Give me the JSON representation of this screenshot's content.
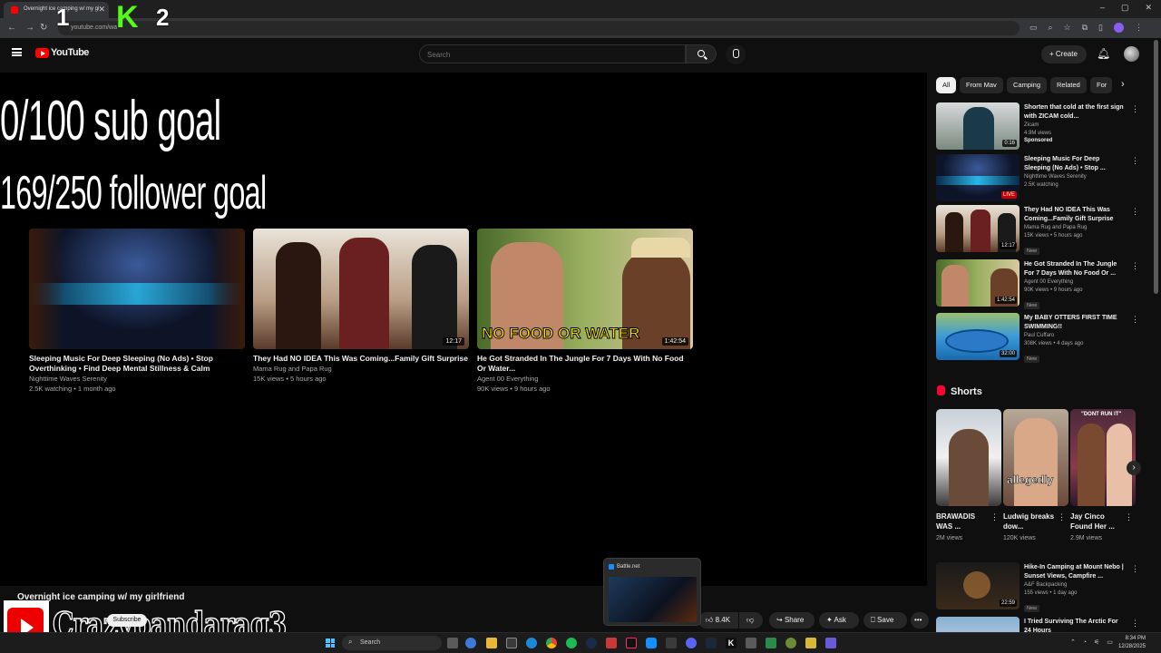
{
  "browser": {
    "tab_title": "Overnight ice camping w/ my gi",
    "url": "youtube.com/wa",
    "window_controls": [
      "–",
      "▢",
      "✕"
    ],
    "overlay_numbers": [
      "1",
      "2"
    ],
    "kick_logo": "K"
  },
  "header": {
    "brand": "YouTube",
    "search_placeholder": "Search",
    "create_label": "Create"
  },
  "player": {
    "goals": [
      "0/100 sub goal",
      "169/250 follower goal"
    ],
    "end_cards": [
      {
        "title": "Sleeping Music For Deep Sleeping (No Ads) • Stop Overthinking • Find Deep Mental Stillness & Calm",
        "channel": "Nighttime Waves Serenity",
        "meta": "2.5K watching • 1 month ago",
        "duration": ""
      },
      {
        "title": "They Had NO IDEA This Was Coming...Family Gift Surprise",
        "channel": "Mama Rug and Papa Rug",
        "meta": "15K views • 5 hours ago",
        "duration": "12:17"
      },
      {
        "title": "He Got Stranded In The Jungle For 7 Days With No Food Or Water...",
        "channel": "Agent 00 Everything",
        "meta": "90K views • 9 hours ago",
        "duration": "1:42:54",
        "thumb_text": "NO FOOD OR WATER"
      }
    ]
  },
  "video": {
    "title": "Overnight ice camping w/ my girlfriend",
    "subscribe_label": "Subscribe",
    "streamer_name": "Crazypandarag3",
    "actions": {
      "likes": "8.4K",
      "share": "Share",
      "ask": "Ask",
      "save": "Save",
      "more": "•••"
    }
  },
  "chips": [
    "All",
    "From Mav",
    "Camping",
    "Related",
    "For"
  ],
  "recommendations": [
    {
      "title": "Shorten that cold at the first sign with ZICAM cold...",
      "channel": "Zicam",
      "meta": "4.9M views",
      "badge": "",
      "sponsored": "Sponsored",
      "duration": "0:16"
    },
    {
      "title": "Sleeping Music For Deep Sleeping (No Ads) • Stop ...",
      "channel": "Nighttime Waves Serenity",
      "meta": "2.5K watching",
      "badge": "",
      "sponsored": "",
      "duration": "LIVE"
    },
    {
      "title": "They Had NO IDEA This Was Coming...Family Gift Surprise",
      "channel": "Mama Rug and Papa Rug",
      "meta": "15K views • 5 hours ago",
      "badge": "New",
      "sponsored": "",
      "duration": "12:17"
    },
    {
      "title": "He Got Stranded In The Jungle For 7 Days With No Food Or ...",
      "channel": "Agent 00 Everything",
      "meta": "90K views • 9 hours ago",
      "badge": "New",
      "sponsored": "",
      "duration": "1:42:54"
    },
    {
      "title": "My BABY OTTERS FIRST TIME SWIMMING!!",
      "channel": "Paul Cuffaro",
      "meta": "308K views • 4 days ago",
      "badge": "New",
      "sponsored": "",
      "duration": "32:00"
    },
    {
      "title": "Hike-In Camping at Mount Nebo | Sunset Views, Campfire ...",
      "channel": "A&F Backpacking",
      "meta": "155 views • 1 day ago",
      "badge": "New",
      "sponsored": "",
      "duration": "22:59"
    },
    {
      "title": "I Tried Surviving The Arctic For 24 Hours",
      "channel": "",
      "meta": "",
      "badge": "",
      "sponsored": "",
      "duration": ""
    }
  ],
  "shorts": {
    "heading": "Shorts",
    "items": [
      {
        "title": "BRAWADIS WAS ...",
        "views": "2M views"
      },
      {
        "title": "Ludwig breaks dow...",
        "views": "120K views",
        "thumb_text": "allegedly"
      },
      {
        "title": "Jay Cinco Found Her ...",
        "views": "2.9M views",
        "thumb_text": "\"DONT RUN IT\""
      }
    ]
  },
  "preview": {
    "title": "Battle.net"
  },
  "taskbar": {
    "search": "Search",
    "time": "8:34 PM",
    "date": "12/28/2025"
  },
  "colors": {
    "accent": "#ff0000",
    "kick": "#53fc18",
    "background": "#0f0f0f"
  }
}
